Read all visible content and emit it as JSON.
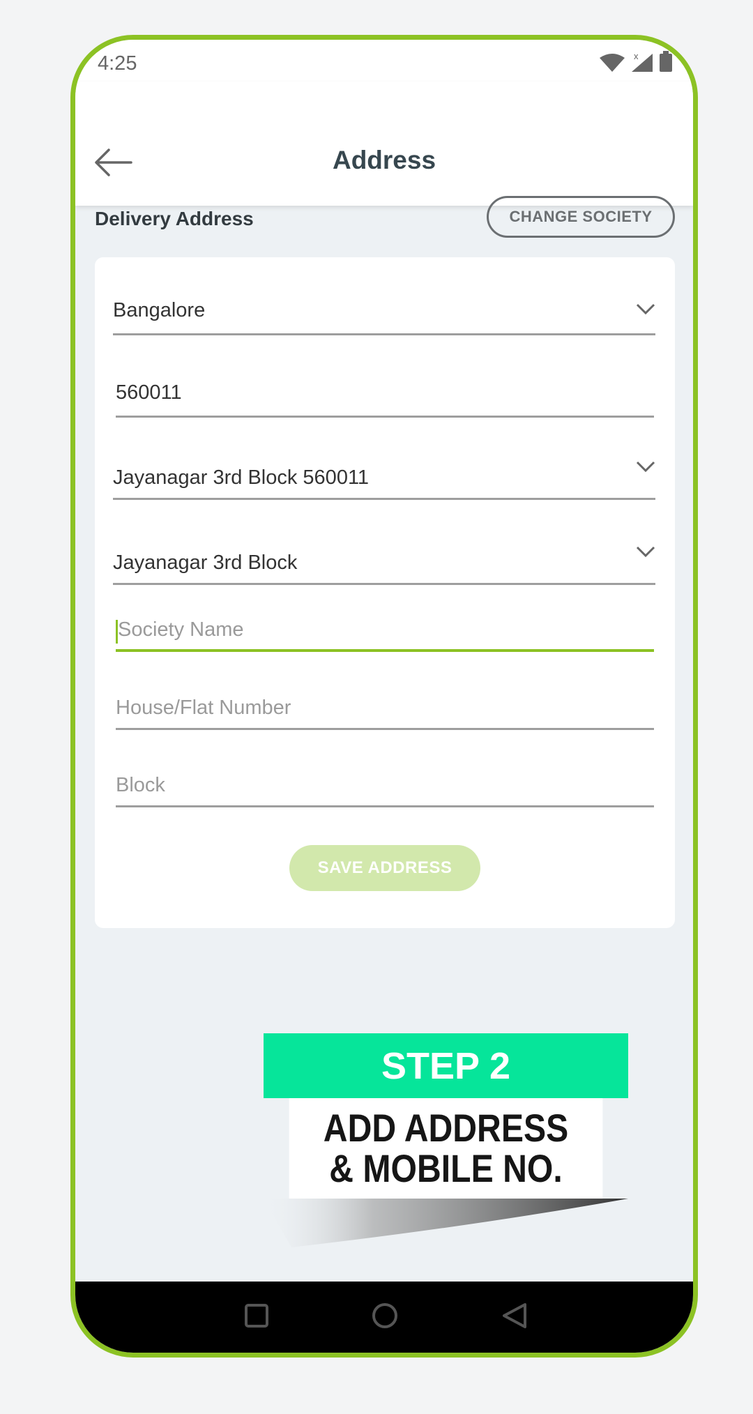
{
  "status_bar": {
    "time": "4:25",
    "icons": [
      "wifi-icon",
      "signal-icon",
      "battery-icon"
    ],
    "signal_mark": "x"
  },
  "app_bar": {
    "back_icon": "arrow-left-icon",
    "title": "Address"
  },
  "section": {
    "label": "Delivery Address",
    "change_button": "CHANGE SOCIETY"
  },
  "form": {
    "city": {
      "value": "Bangalore",
      "icon": "chevron-down-icon"
    },
    "pincode": {
      "value": "560011"
    },
    "area": {
      "value": "Jayanagar 3rd Block 560011",
      "icon": "chevron-down-icon"
    },
    "locality": {
      "value": "Jayanagar 3rd Block",
      "icon": "chevron-down-icon"
    },
    "society": {
      "value": "",
      "placeholder": "Society Name"
    },
    "house": {
      "value": "",
      "placeholder": "House/Flat Number"
    },
    "block": {
      "value": "",
      "placeholder": "Block"
    },
    "save_button": "SAVE ADDRESS"
  },
  "nav_bar": {
    "icons": [
      "recent-apps-icon",
      "home-icon",
      "back-triangle-icon"
    ]
  },
  "banner": {
    "step": "STEP 2",
    "line1": "ADD ADDRESS",
    "line2": "& MOBILE NO."
  },
  "colors": {
    "accent": "#8cc224",
    "banner_green": "#06e59a",
    "save_disabled": "#d2e8ac",
    "background": "#edf1f4"
  }
}
